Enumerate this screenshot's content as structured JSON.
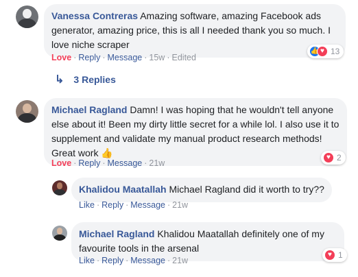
{
  "comments": [
    {
      "author": "Vanessa Contreras",
      "text": "Amazing software, amazing Facebook ads generator, amazing price, this is all I needed thank you so much. I love niche scraper",
      "love": "Love",
      "reply": "Reply",
      "message": "Message",
      "time": "15w",
      "edited": "Edited",
      "reactions": {
        "icons": [
          "like-icon",
          "heart-icon"
        ],
        "count": "13"
      }
    },
    {
      "author": "Michael Ragland",
      "text": "Damn! I was hoping that he wouldn't tell anyone else about it! Been my dirty little secret for a while lol. I also use it to supplement and validate my manual product research methods! Great work",
      "emoji": "👍",
      "love": "Love",
      "reply": "Reply",
      "message": "Message",
      "time": "21w",
      "reactions": {
        "icons": [
          "heart-icon"
        ],
        "count": "2"
      }
    }
  ],
  "replies_toggle": "3 Replies",
  "replies": [
    {
      "author": "Khalidou Maatallah",
      "text": "Michael Ragland did it worth to try??",
      "like": "Like",
      "reply": "Reply",
      "message": "Message",
      "time": "21w"
    },
    {
      "author": "Michael Ragland",
      "text": "Khalidou Maatallah definitely one of my favourite tools in the arsenal",
      "like": "Like",
      "reply": "Reply",
      "message": "Message",
      "time": "21w",
      "reactions": {
        "icons": [
          "heart-icon"
        ],
        "count": "1"
      }
    }
  ],
  "colors": {
    "link": "#385898",
    "love": "#f33e58",
    "bubble": "#f2f3f5",
    "like": "#1877f2"
  }
}
